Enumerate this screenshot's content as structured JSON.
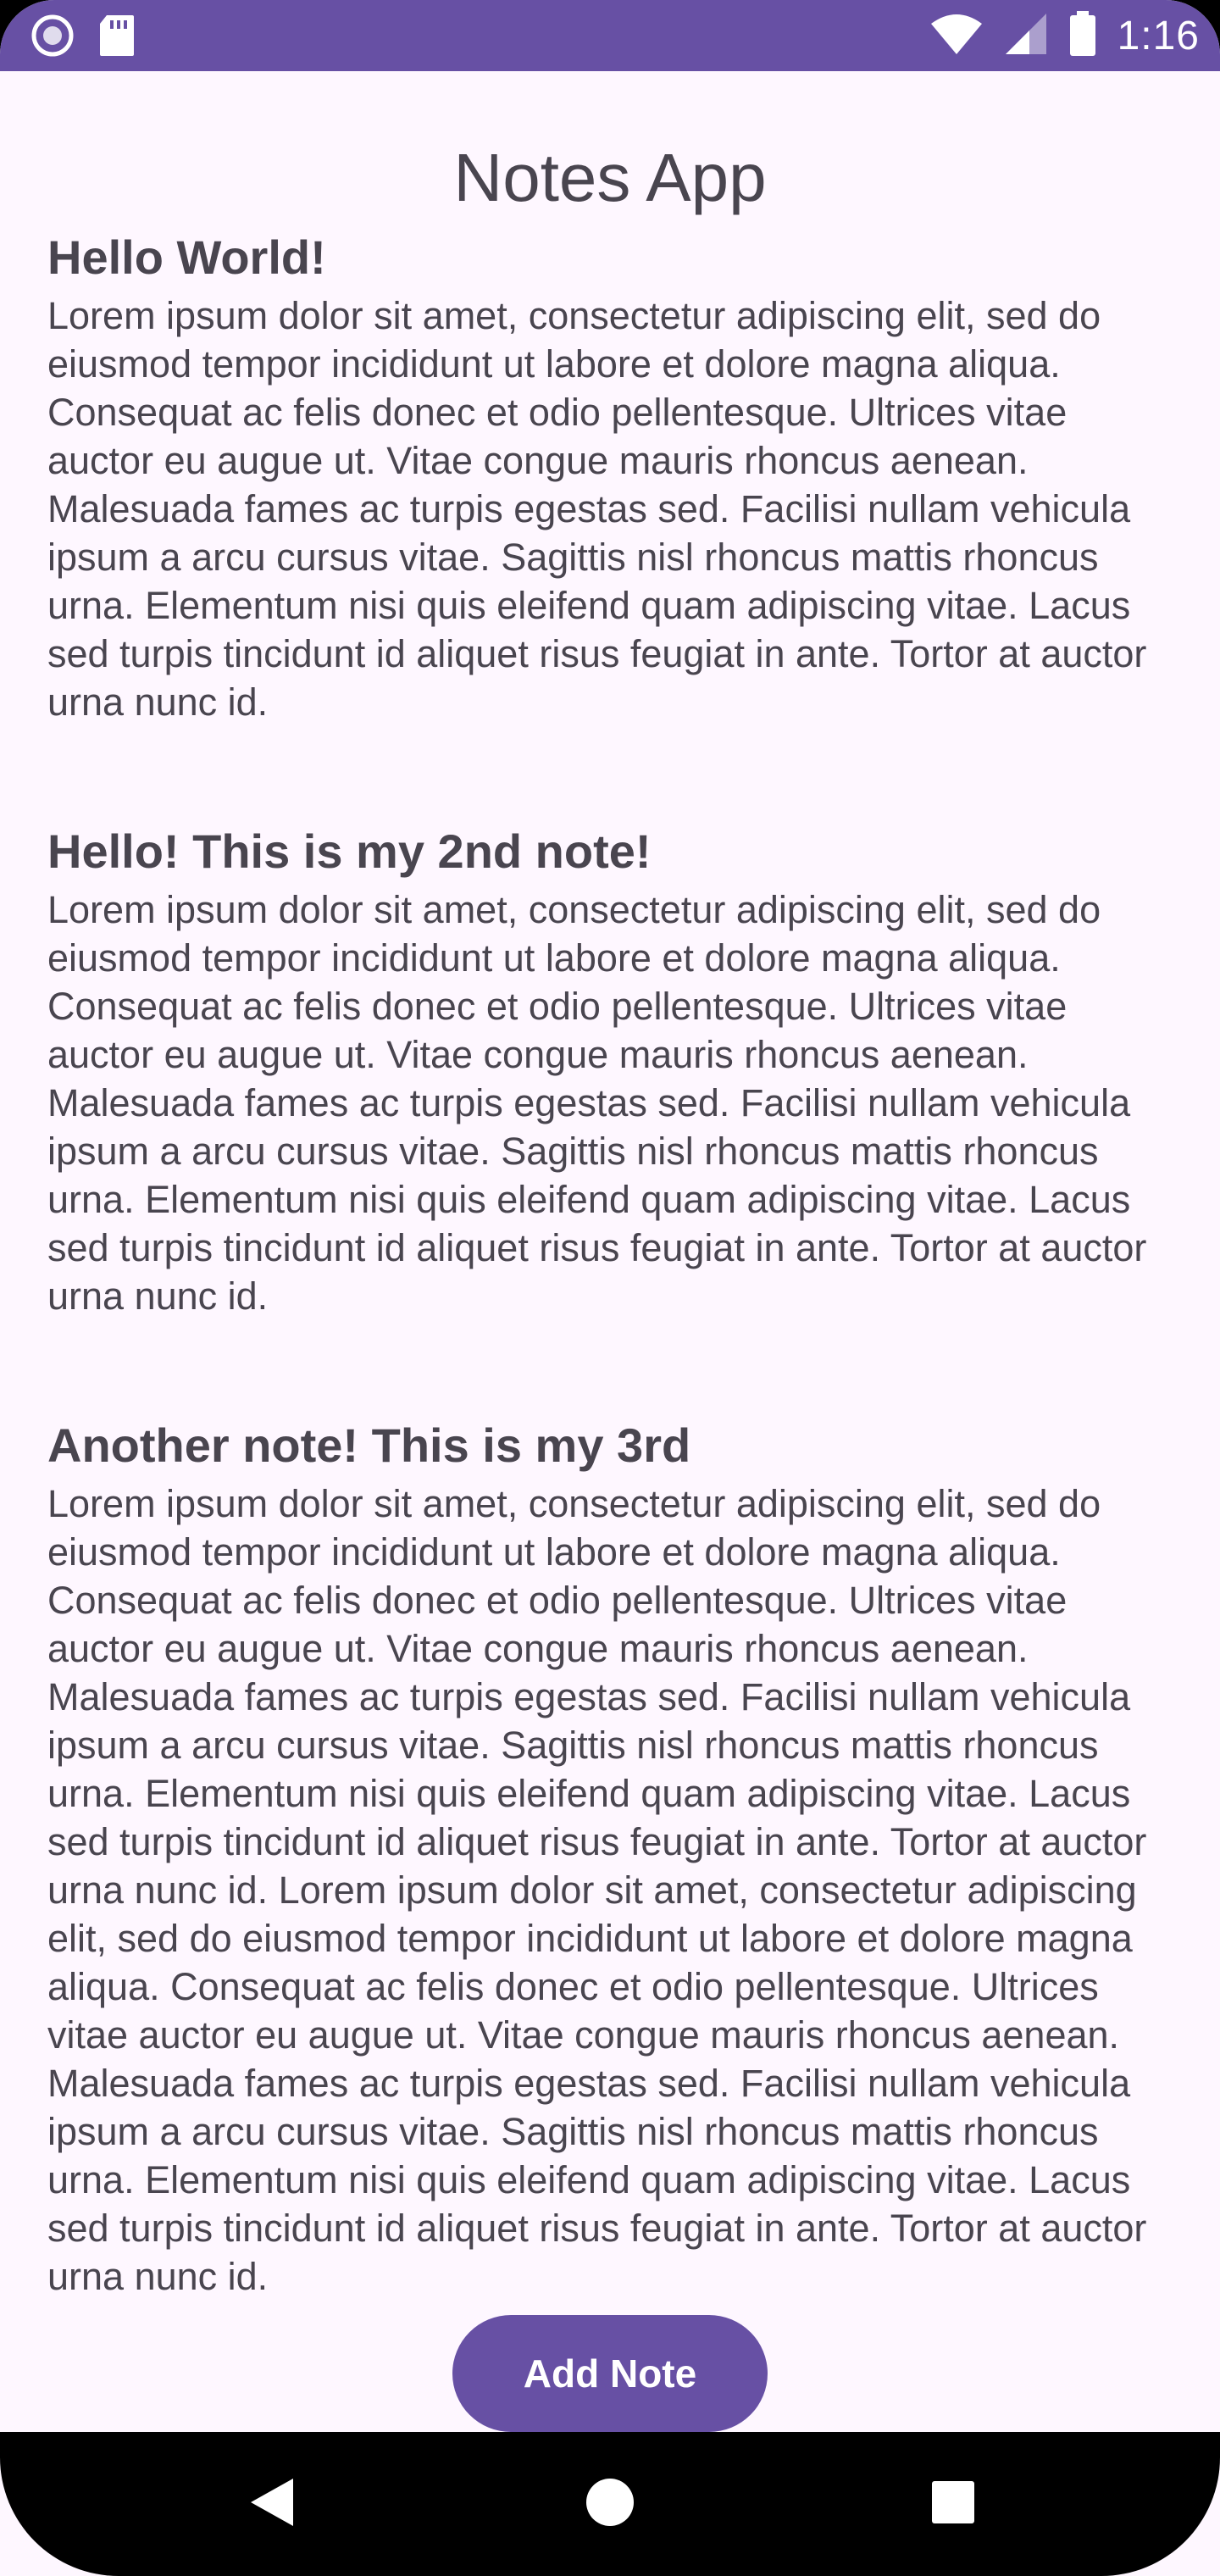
{
  "status_bar": {
    "time": "1:16",
    "icons": [
      "app-icon",
      "sd-card-icon",
      "wifi-icon",
      "signal-icon",
      "battery-icon"
    ],
    "color": "#6750A4"
  },
  "app": {
    "title": "Notes App"
  },
  "notes": [
    {
      "title": "Hello World!",
      "body": "Lorem ipsum dolor sit amet, consectetur adipiscing elit, sed do eiusmod tempor incididunt ut labore et dolore magna aliqua. Consequat ac felis donec et odio pellentesque. Ultrices vitae auctor eu augue ut. Vitae congue mauris rhoncus aenean. Malesuada fames ac turpis egestas sed. Facilisi nullam vehicula ipsum a arcu cursus vitae. Sagittis nisl rhoncus mattis rhoncus urna. Elementum nisi quis eleifend quam adipiscing vitae. Lacus sed turpis tincidunt id aliquet risus feugiat in ante. Tortor at auctor urna nunc id."
    },
    {
      "title": "Hello! This is my 2nd note!",
      "body": "Lorem ipsum dolor sit amet, consectetur adipiscing elit, sed do eiusmod tempor incididunt ut labore et dolore magna aliqua. Consequat ac felis donec et odio pellentesque. Ultrices vitae auctor eu augue ut. Vitae congue mauris rhoncus aenean. Malesuada fames ac turpis egestas sed. Facilisi nullam vehicula ipsum a arcu cursus vitae. Sagittis nisl rhoncus mattis rhoncus urna. Elementum nisi quis eleifend quam adipiscing vitae. Lacus sed turpis tincidunt id aliquet risus feugiat in ante. Tortor at auctor urna nunc id."
    },
    {
      "title": "Another note! This is my 3rd",
      "body": "Lorem ipsum dolor sit amet, consectetur adipiscing elit, sed do eiusmod tempor incididunt ut labore et dolore magna aliqua. Consequat ac felis donec et odio pellentesque. Ultrices vitae auctor eu augue ut. Vitae congue mauris rhoncus aenean. Malesuada fames ac turpis egestas sed. Facilisi nullam vehicula ipsum a arcu cursus vitae. Sagittis nisl rhoncus mattis rhoncus urna. Elementum nisi quis eleifend quam adipiscing vitae. Lacus sed turpis tincidunt id aliquet risus feugiat in ante. Tortor at auctor urna nunc id. Lorem ipsum dolor sit amet, consectetur adipiscing elit, sed do eiusmod tempor incididunt ut labore et dolore magna aliqua. Consequat ac felis donec et odio pellentesque. Ultrices vitae auctor eu augue ut. Vitae congue mauris rhoncus aenean. Malesuada fames ac turpis egestas sed. Facilisi nullam vehicula ipsum a arcu cursus vitae. Sagittis nisl rhoncus mattis rhoncus urna. Elementum nisi quis eleifend quam adipiscing vitae. Lacus sed turpis tincidunt id aliquet risus feugiat in ante. Tortor at auctor urna nunc id."
    }
  ],
  "add_note_button": {
    "label": "Add Note",
    "color": "#6750A4"
  },
  "nav_bar": {
    "buttons": [
      "back-icon",
      "home-icon",
      "recents-icon"
    ]
  }
}
